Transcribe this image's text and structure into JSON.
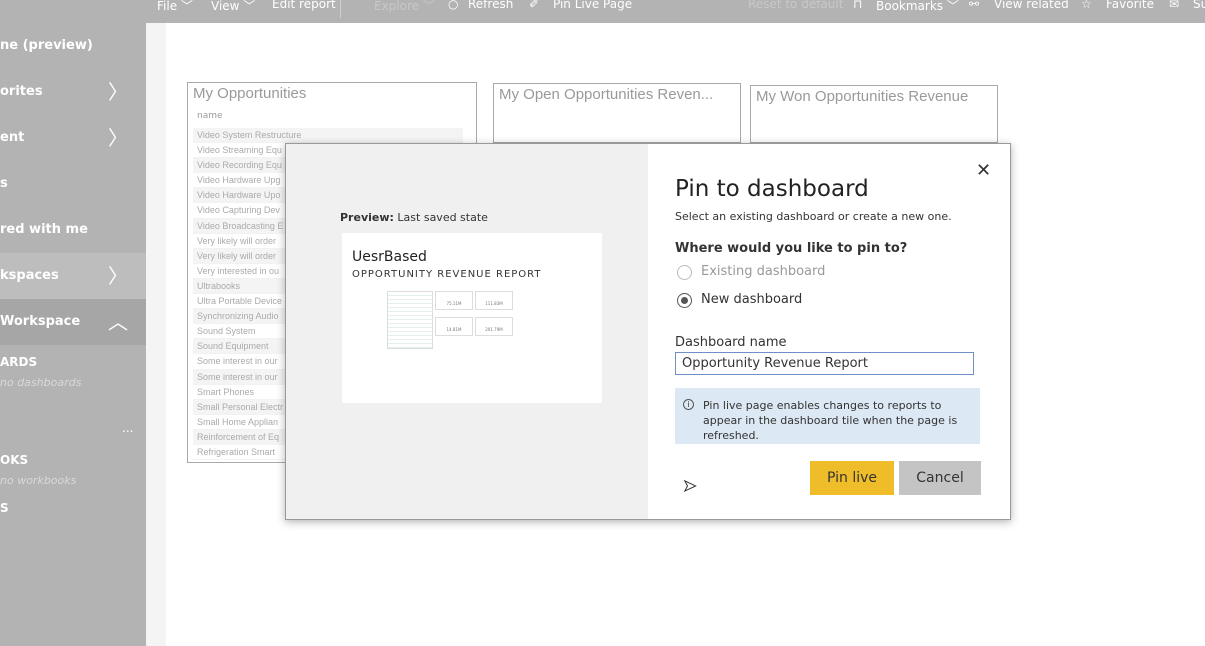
{
  "toolbar": {
    "items": [
      {
        "label": "File ﹀"
      },
      {
        "label": "View ﹀"
      },
      {
        "label": "Edit report"
      },
      {
        "label": "Explore ﹀"
      },
      {
        "label": "Refresh"
      },
      {
        "label": "Pin Live Page"
      },
      {
        "label": "Reset to default"
      },
      {
        "label": "Bookmarks ﹀"
      },
      {
        "label": "View related"
      },
      {
        "label": "Favorite"
      },
      {
        "label": "Su"
      }
    ]
  },
  "sidebar": {
    "items": [
      {
        "label": "ne (preview)"
      },
      {
        "label": "orites"
      },
      {
        "label": "ent"
      },
      {
        "label": "s"
      },
      {
        "label": "red with me"
      },
      {
        "label": "kspaces"
      },
      {
        "label": "Workspace"
      }
    ],
    "dashboards_header": "ARDS",
    "dashboards_empty": "no dashboards",
    "more": "...",
    "workbooks_header": "OKS",
    "workbooks_empty": "no workbooks",
    "datasets_header": "S"
  },
  "tiles": {
    "opportunities": {
      "title": "My Opportunities",
      "column": "name",
      "rows": [
        "Video System Restructure",
        "Video Streaming Equ",
        "Video Recording Equ",
        "Video Hardware Upg",
        "Video Hardware Upo",
        "Video Capturing Dev",
        "Video Broadcasting E",
        "Very likely will order",
        "Very likely will order",
        "Very interested in ou",
        "Ultrabooks",
        "Ultra Portable Device",
        "Synchronizing Audio",
        "Sound System",
        "Sound Equipment",
        "Some interest in our",
        "Some interest in our",
        "Smart Phones",
        "Small Personal Electr",
        "Small Home Applian",
        "Reinforcement of Eq",
        "Refrigeration Smart"
      ]
    },
    "open": {
      "title": "My Open Opportunities Reven..."
    },
    "won": {
      "title": "My Won Opportunities Revenue"
    }
  },
  "dialog": {
    "preview_label": "Preview:",
    "preview_state": "Last saved state",
    "thumb_title": "UesrBased",
    "thumb_subtitle": "OPPORTUNITY REVENUE REPORT",
    "thumb_values": [
      "75.11M",
      "111.83M",
      "14.81M",
      "201.79M"
    ],
    "title": "Pin to dashboard",
    "subtitle": "Select an existing dashboard or create a new one.",
    "question": "Where would you like to pin to?",
    "options": [
      {
        "label": "Existing dashboard",
        "selected": false,
        "disabled": true
      },
      {
        "label": "New dashboard",
        "selected": true
      }
    ],
    "name_label": "Dashboard name",
    "name_value": "Opportunity Revenue Report",
    "info": "Pin live page enables changes to reports to appear in the dashboard tile when the page is refreshed.",
    "pin_label": "Pin live",
    "cancel_label": "Cancel",
    "close": "✕"
  },
  "colors": {
    "pin": "#f0bd2a",
    "cancel": "#c4c4c4",
    "info_bg": "#dce8f3"
  }
}
